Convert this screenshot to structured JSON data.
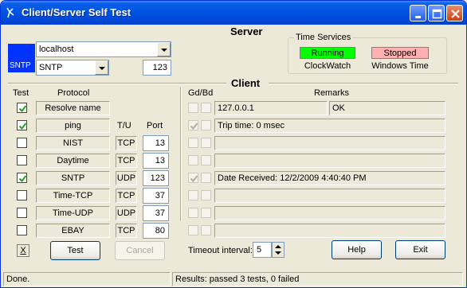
{
  "window": {
    "title": "Client/Server Self Test"
  },
  "server": {
    "title": "Server",
    "host": "localhost",
    "protocol": "SNTP",
    "port": "123",
    "icon_label": "SNTP",
    "icon_color": "#0033ff"
  },
  "time_services": {
    "title": "Time Services",
    "items": [
      {
        "status": "Running",
        "name": "ClockWatch",
        "color": "#00ff00"
      },
      {
        "status": "Stopped",
        "name": "Windows Time",
        "color": "#ffb0b0"
      }
    ]
  },
  "client": {
    "title": "Client",
    "headers": {
      "test": "Test",
      "protocol": "Protocol",
      "tu": "T/U",
      "port": "Port",
      "gdbd": "Gd/Bd",
      "remarks": "Remarks"
    },
    "rows": [
      {
        "checked": true,
        "protocol": "Resolve name",
        "tu": "",
        "port": "",
        "gd": false,
        "bd": false,
        "remark1": "127.0.0.1",
        "remark2": "OK"
      },
      {
        "checked": true,
        "protocol": "ping",
        "tu": "",
        "port": "",
        "gd": true,
        "bd": false,
        "remark1": "Trip time: 0 msec",
        "remark2": ""
      },
      {
        "checked": false,
        "protocol": "NIST",
        "tu": "TCP",
        "port": "13",
        "gd": false,
        "bd": false,
        "remark1": "",
        "remark2": ""
      },
      {
        "checked": false,
        "protocol": "Daytime",
        "tu": "TCP",
        "port": "13",
        "gd": false,
        "bd": false,
        "remark1": "",
        "remark2": ""
      },
      {
        "checked": true,
        "protocol": "SNTP",
        "tu": "UDP",
        "port": "123",
        "gd": true,
        "bd": false,
        "remark1": "Date Received: 12/2/2009 4:40:40 PM",
        "remark2": ""
      },
      {
        "checked": false,
        "protocol": "Time-TCP",
        "tu": "TCP",
        "port": "37",
        "gd": false,
        "bd": false,
        "remark1": "",
        "remark2": ""
      },
      {
        "checked": false,
        "protocol": "Time-UDP",
        "tu": "UDP",
        "port": "37",
        "gd": false,
        "bd": false,
        "remark1": "",
        "remark2": ""
      },
      {
        "checked": false,
        "protocol": "EBAY",
        "tu": "TCP",
        "port": "80",
        "gd": false,
        "bd": false,
        "remark1": "",
        "remark2": ""
      }
    ]
  },
  "buttons": {
    "clear": "X",
    "test": "Test",
    "cancel": "Cancel",
    "help": "Help",
    "exit": "Exit"
  },
  "timeout": {
    "label": "Timeout interval:",
    "value": "5"
  },
  "status": {
    "left": "Done.",
    "right": "Results: passed 3 tests, 0 failed"
  }
}
